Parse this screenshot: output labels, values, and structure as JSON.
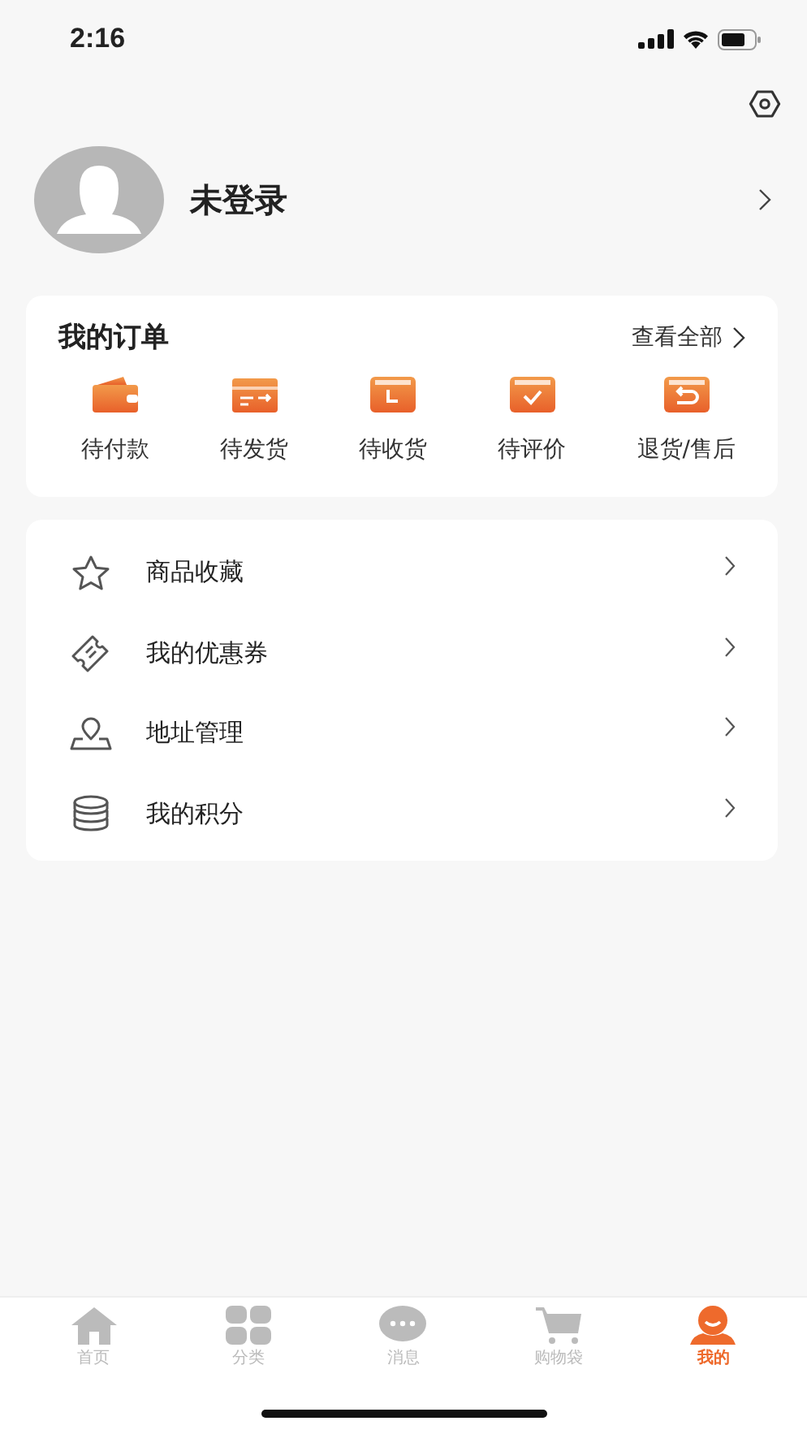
{
  "status_bar": {
    "time": "2:16"
  },
  "profile": {
    "name": "未登录"
  },
  "orders": {
    "title": "我的订单",
    "view_all": "查看全部",
    "items": [
      {
        "kind": "wallet",
        "label": "待付款"
      },
      {
        "kind": "card",
        "label": "待发货"
      },
      {
        "kind": "clock",
        "label": "待收货"
      },
      {
        "kind": "check",
        "label": "待评价"
      },
      {
        "kind": "return",
        "label": "退货/售后"
      }
    ]
  },
  "menu": [
    {
      "kind": "star",
      "label": "商品收藏"
    },
    {
      "kind": "ticket",
      "label": "我的优惠券"
    },
    {
      "kind": "pin",
      "label": "地址管理"
    },
    {
      "kind": "coins",
      "label": "我的积分"
    }
  ],
  "tab_bar": [
    {
      "kind": "home",
      "label": "首页",
      "selected": false
    },
    {
      "kind": "grid",
      "label": "分类",
      "selected": false
    },
    {
      "kind": "chat",
      "label": "消息",
      "selected": false
    },
    {
      "kind": "cart",
      "label": "购物袋",
      "selected": false
    },
    {
      "kind": "me",
      "label": "我的",
      "selected": true
    }
  ]
}
